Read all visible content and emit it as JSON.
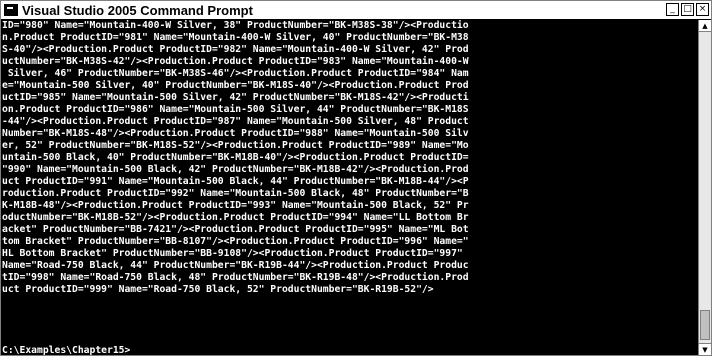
{
  "window": {
    "title": "Visual Studio 2005 Command Prompt",
    "controls": {
      "minimize": "_",
      "maximize": "□",
      "close": "×"
    }
  },
  "console": {
    "lines": [
      "ID=\"980\" Name=\"Mountain-400-W Silver, 38\" ProductNumber=\"BK-M38S-38\"/><Productio",
      "n.Product ProductID=\"981\" Name=\"Mountain-400-W Silver, 40\" ProductNumber=\"BK-M38",
      "S-40\"/><Production.Product ProductID=\"982\" Name=\"Mountain-400-W Silver, 42\" Prod",
      "uctNumber=\"BK-M38S-42\"/><Production.Product ProductID=\"983\" Name=\"Mountain-400-W",
      " Silver, 46\" ProductNumber=\"BK-M38S-46\"/><Production.Product ProductID=\"984\" Nam",
      "e=\"Mountain-500 Silver, 40\" ProductNumber=\"BK-M18S-40\"/><Production.Product Prod",
      "uctID=\"985\" Name=\"Mountain-500 Silver, 42\" ProductNumber=\"BK-M18S-42\"/><Producti",
      "on.Product ProductID=\"986\" Name=\"Mountain-500 Silver, 44\" ProductNumber=\"BK-M18S",
      "-44\"/><Production.Product ProductID=\"987\" Name=\"Mountain-500 Silver, 48\" Product",
      "Number=\"BK-M18S-48\"/><Production.Product ProductID=\"988\" Name=\"Mountain-500 Silv",
      "er, 52\" ProductNumber=\"BK-M18S-52\"/><Production.Product ProductID=\"989\" Name=\"Mo",
      "untain-500 Black, 40\" ProductNumber=\"BK-M18B-40\"/><Production.Product ProductID=",
      "\"990\" Name=\"Mountain-500 Black, 42\" ProductNumber=\"BK-M18B-42\"/><Production.Prod",
      "uct ProductID=\"991\" Name=\"Mountain-500 Black, 44\" ProductNumber=\"BK-M18B-44\"/><P",
      "roduction.Product ProductID=\"992\" Name=\"Mountain-500 Black, 48\" ProductNumber=\"B",
      "K-M18B-48\"/><Production.Product ProductID=\"993\" Name=\"Mountain-500 Black, 52\" Pr",
      "oductNumber=\"BK-M18B-52\"/><Production.Product ProductID=\"994\" Name=\"LL Bottom Br",
      "acket\" ProductNumber=\"BB-7421\"/><Production.Product ProductID=\"995\" Name=\"ML Bot",
      "tom Bracket\" ProductNumber=\"BB-8107\"/><Production.Product ProductID=\"996\" Name=\"",
      "HL Bottom Bracket\" ProductNumber=\"BB-9108\"/><Production.Product ProductID=\"997\"",
      "Name=\"Road-750 Black, 44\" ProductNumber=\"BK-R19B-44\"/><Production.Product Produc",
      "tID=\"998\" Name=\"Road-750 Black, 48\" ProductNumber=\"BK-R19B-48\"/><Production.Prod",
      "uct ProductID=\"999\" Name=\"Road-750 Black, 52\" ProductNumber=\"BK-R19B-52\"/>",
      ""
    ],
    "prompt": "C:\\Examples\\Chapter15>"
  },
  "colors": {
    "console_background": "#000000",
    "console_text": "#ffffff",
    "titlebar_background": "#ffffff"
  },
  "icons": {
    "app": "cmd-icon",
    "scroll_up": "arrow-up-icon",
    "scroll_down": "arrow-down-icon"
  }
}
